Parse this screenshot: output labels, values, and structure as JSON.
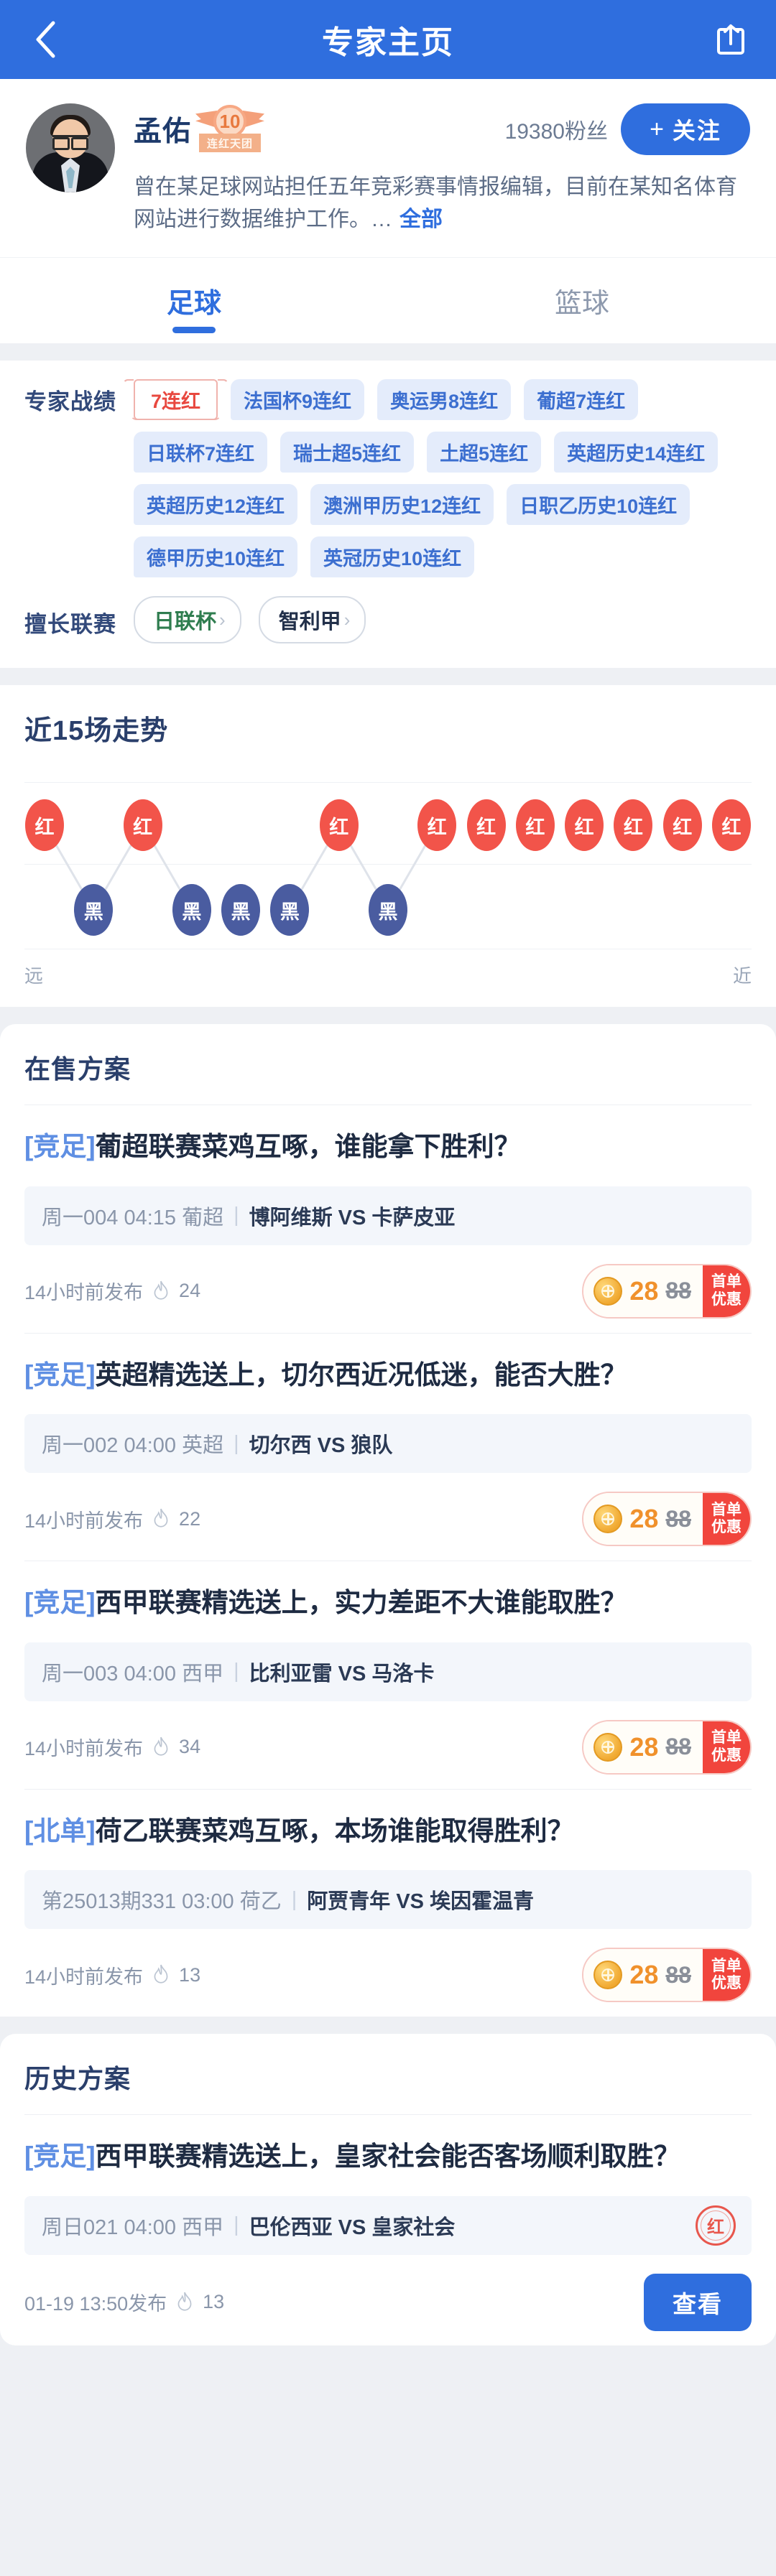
{
  "header": {
    "title": "专家主页",
    "back_icon": "chevron-left-icon",
    "share_icon": "share-icon"
  },
  "profile": {
    "name": "孟佑",
    "badge_number": "10",
    "badge_label": "连红天团",
    "fans": "19380粉丝",
    "follow_label": "关注",
    "follow_plus": "+",
    "bio": "曾在某足球网站担任五年竞彩赛事情报编辑，目前在某知名体育网站进行数据维护工作。…",
    "bio_more": "全部"
  },
  "tabs": [
    {
      "label": "足球",
      "active": true
    },
    {
      "label": "篮球",
      "active": false
    }
  ],
  "stats": {
    "label": "专家战绩",
    "hot_tag": "7连红",
    "tags": [
      "法国杯9连红",
      "奥运男8连红",
      "葡超7连红",
      "日联杯7连红",
      "瑞士超5连红",
      "土超5连红",
      "英超历史14连红",
      "英超历史12连红",
      "澳洲甲历史12连红",
      "日职乙历史10连红",
      "德甲历史10连红",
      "英冠历史10连红"
    ]
  },
  "leagues": {
    "label": "擅长联赛",
    "items": [
      {
        "name": "日联杯",
        "style": "green"
      },
      {
        "name": "智利甲",
        "style": "dark"
      }
    ]
  },
  "trend": {
    "title": "近15场走势",
    "axis_left": "远",
    "axis_right": "近"
  },
  "chart_data": {
    "type": "line",
    "title": "近15场走势",
    "xlabel": "",
    "ylabel": "",
    "categories": [
      "1",
      "2",
      "3",
      "4",
      "5",
      "6",
      "7",
      "8",
      "9",
      "10",
      "11",
      "12",
      "13",
      "14",
      "15"
    ],
    "values": [
      "红",
      "黑",
      "红",
      "黑",
      "黑",
      "黑",
      "红",
      "黑",
      "红",
      "红",
      "红",
      "红",
      "红",
      "红",
      "红"
    ],
    "legend": [
      "红",
      "黑"
    ],
    "colors": {
      "red": "#f2544a",
      "black": "#4a5ca0"
    },
    "axis_annotations": {
      "left": "远",
      "right": "近"
    },
    "grid": true
  },
  "on_sale": {
    "title": "在售方案",
    "plans": [
      {
        "category": "[竞足]",
        "title": "葡超联赛菜鸡互啄，谁能拿下胜利？",
        "match_meta": "周一004 04:15 葡超",
        "sep": "|",
        "teams": "博阿维斯 VS 卡萨皮亚",
        "published": "14小时前发布",
        "heat": "24",
        "price_now": "28",
        "price_was": "88",
        "promo_line1": "首单",
        "promo_line2": "优惠"
      },
      {
        "category": "[竞足]",
        "title": "英超精选送上，切尔西近况低迷，能否大胜？",
        "match_meta": "周一002 04:00 英超",
        "sep": "|",
        "teams": "切尔西 VS 狼队",
        "published": "14小时前发布",
        "heat": "22",
        "price_now": "28",
        "price_was": "88",
        "promo_line1": "首单",
        "promo_line2": "优惠"
      },
      {
        "category": "[竞足]",
        "title": "西甲联赛精选送上，实力差距不大谁能取胜？",
        "match_meta": "周一003 04:00 西甲",
        "sep": "|",
        "teams": "比利亚雷 VS 马洛卡",
        "published": "14小时前发布",
        "heat": "34",
        "price_now": "28",
        "price_was": "88",
        "promo_line1": "首单",
        "promo_line2": "优惠"
      },
      {
        "category": "[北单]",
        "title": "荷乙联赛菜鸡互啄，本场谁能取得胜利？",
        "match_meta": "第25013期331 03:00 荷乙",
        "sep": "|",
        "teams": "阿贾青年 VS 埃因霍温青",
        "published": "14小时前发布",
        "heat": "13",
        "price_now": "28",
        "price_was": "88",
        "promo_line1": "首单",
        "promo_line2": "优惠"
      }
    ]
  },
  "history": {
    "title": "历史方案",
    "plans": [
      {
        "category": "[竞足]",
        "title": "西甲联赛精选送上，皇家社会能否客场顺利取胜？",
        "match_meta": "周日021 04:00 西甲",
        "sep": "|",
        "teams": "巴伦西亚 VS 皇家社会",
        "stamp": "红",
        "published": "01-19 13:50发布",
        "heat": "13",
        "view_label": "查看"
      }
    ]
  },
  "colors": {
    "brand": "#2f6ede",
    "red": "#f2544a",
    "dark_blue": "#4a5ca0",
    "promo_red": "#f1453d",
    "price_orange": "#f0912c"
  }
}
